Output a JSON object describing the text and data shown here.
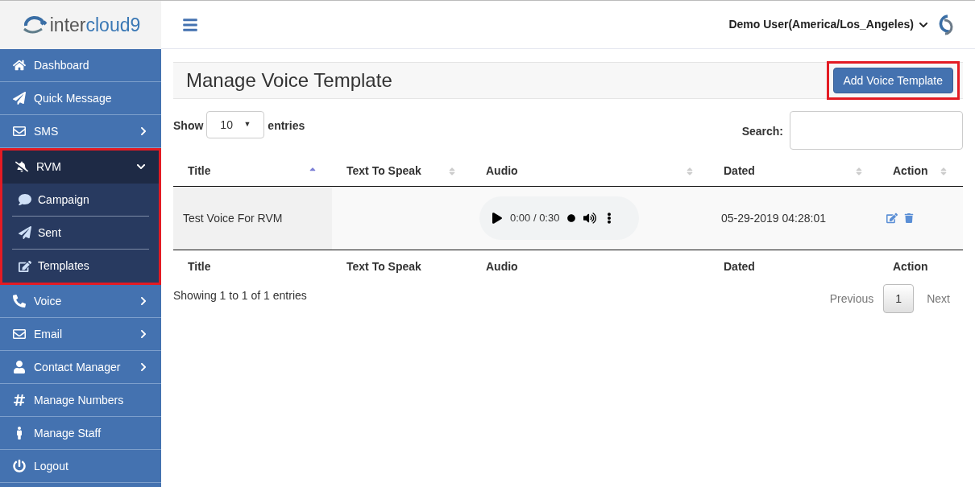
{
  "brand": {
    "text_a": "inter",
    "text_b": "cloud9"
  },
  "sidebar": {
    "items": [
      {
        "label": "Dashboard",
        "has_children": false,
        "expanded": false,
        "highlighted": false
      },
      {
        "label": "Quick Message",
        "has_children": false,
        "expanded": false,
        "highlighted": false
      },
      {
        "label": "SMS",
        "has_children": true,
        "expanded": false,
        "highlighted": false
      },
      {
        "label": "RVM",
        "has_children": true,
        "expanded": true,
        "highlighted": true,
        "children": [
          {
            "label": "Campaign"
          },
          {
            "label": "Sent"
          },
          {
            "label": "Templates"
          }
        ]
      },
      {
        "label": "Voice",
        "has_children": true,
        "expanded": false,
        "highlighted": false
      },
      {
        "label": "Email",
        "has_children": true,
        "expanded": false,
        "highlighted": false
      },
      {
        "label": "Contact Manager",
        "has_children": true,
        "expanded": false,
        "highlighted": false
      },
      {
        "label": "Manage Numbers",
        "has_children": false,
        "expanded": false,
        "highlighted": false
      },
      {
        "label": "Manage Staff",
        "has_children": false,
        "expanded": false,
        "highlighted": false
      },
      {
        "label": "Logout",
        "has_children": false,
        "expanded": false,
        "highlighted": false
      }
    ]
  },
  "header": {
    "user": "Demo User(America/Los_Angeles)"
  },
  "page": {
    "title": "Manage Voice Template",
    "add_button": {
      "label": "Add Voice Template",
      "highlighted": true
    }
  },
  "controls": {
    "show_label": "Show",
    "page_size": "10",
    "page_size_arrow": "▼",
    "entries_label": "entries",
    "search_label": "Search:"
  },
  "table": {
    "columns": [
      {
        "label": "Title",
        "sorted": true
      },
      {
        "label": "Text To Speak",
        "sorted": false
      },
      {
        "label": "Audio",
        "sorted": false
      },
      {
        "label": "Dated",
        "sorted": false
      },
      {
        "label": "Action",
        "sorted": false
      }
    ],
    "rows": [
      {
        "title": "Test Voice For RVM",
        "audio_time": "0:00 / 0:30",
        "dated": "05-29-2019 04:28:01"
      }
    ],
    "footer": [
      "Title",
      "Text To Speak",
      "Audio",
      "Dated",
      "Action"
    ]
  },
  "info": "Showing 1 to 1 of 1 entries",
  "pagination": {
    "previous": "Previous",
    "pages": [
      {
        "label": "1",
        "selected": true
      }
    ],
    "next": "Next"
  }
}
